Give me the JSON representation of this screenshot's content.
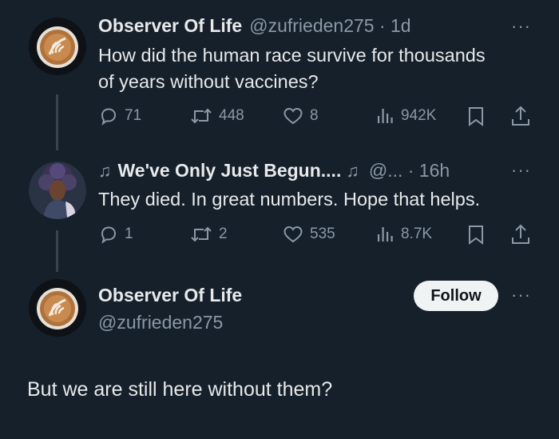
{
  "tweet1": {
    "name": "Observer Of Life",
    "handle_time": "@zufrieden275 · 1d",
    "text_line1": "How did the human race survive for thousands",
    "text_line2": "of years without vaccines?",
    "replies": "71",
    "retweets": "448",
    "likes": "8",
    "views": "942K"
  },
  "tweet2": {
    "name": "We've Only Just Begun....",
    "handle_time": "@... · 16h",
    "text": "They died. In great numbers. Hope that helps.",
    "replies": "1",
    "retweets": "2",
    "likes": "535",
    "views": "8.7K"
  },
  "main_tweet": {
    "name": "Observer Of Life",
    "handle": "@zufrieden275",
    "follow_label": "Follow",
    "text": "But we are still here without them?"
  },
  "colors": {
    "background": "#15202b",
    "text": "#e7e9ea",
    "secondary": "#8b98a5",
    "thread_line": "#38444d"
  },
  "icons": [
    "reply-icon",
    "retweet-icon",
    "like-icon",
    "views-icon",
    "bookmark-icon",
    "share-icon",
    "more-icon",
    "music-note-icon"
  ]
}
